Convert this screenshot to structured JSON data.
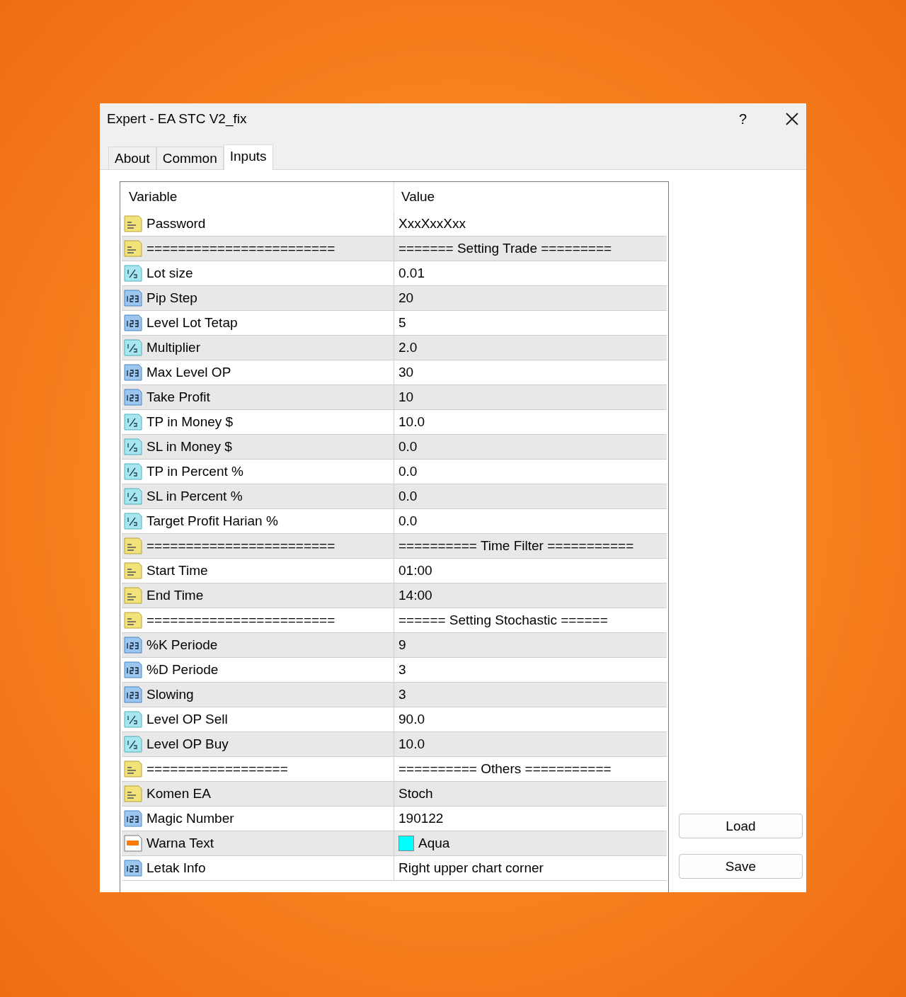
{
  "window": {
    "title": "Expert - EA STC V2_fix",
    "help": "?"
  },
  "tabs": [
    {
      "label": "About",
      "selected": false
    },
    {
      "label": "Common",
      "selected": false
    },
    {
      "label": "Inputs",
      "selected": true
    }
  ],
  "table": {
    "columns": [
      "Variable",
      "Value"
    ],
    "rows": [
      {
        "kind": "string",
        "variable": "Password",
        "value": "XxxXxxXxx"
      },
      {
        "kind": "string",
        "variable": "========================",
        "value": "======= Setting Trade ========="
      },
      {
        "kind": "double",
        "variable": "Lot size",
        "value": "0.01"
      },
      {
        "kind": "int",
        "variable": "Pip Step",
        "value": "20"
      },
      {
        "kind": "int",
        "variable": "Level Lot Tetap",
        "value": "5"
      },
      {
        "kind": "double",
        "variable": "Multiplier",
        "value": "2.0"
      },
      {
        "kind": "int",
        "variable": "Max Level OP",
        "value": "30"
      },
      {
        "kind": "int",
        "variable": "Take Profit",
        "value": "10"
      },
      {
        "kind": "double",
        "variable": "TP in Money $",
        "value": "10.0"
      },
      {
        "kind": "double",
        "variable": "SL in Money $",
        "value": "0.0"
      },
      {
        "kind": "double",
        "variable": "TP in Percent %",
        "value": "0.0"
      },
      {
        "kind": "double",
        "variable": "SL in Percent %",
        "value": "0.0"
      },
      {
        "kind": "double",
        "variable": "Target Profit Harian %",
        "value": "0.0"
      },
      {
        "kind": "string",
        "variable": "========================",
        "value": "========== Time Filter ==========="
      },
      {
        "kind": "string",
        "variable": "Start Time",
        "value": "01:00"
      },
      {
        "kind": "string",
        "variable": "End Time",
        "value": "14:00"
      },
      {
        "kind": "string",
        "variable": "========================",
        "value": "======  Setting Stochastic ======"
      },
      {
        "kind": "int",
        "variable": "%K Periode",
        "value": "9"
      },
      {
        "kind": "int",
        "variable": "%D Periode",
        "value": "3"
      },
      {
        "kind": "int",
        "variable": "Slowing",
        "value": "3"
      },
      {
        "kind": "double",
        "variable": "Level OP Sell",
        "value": "90.0"
      },
      {
        "kind": "double",
        "variable": "Level OP Buy",
        "value": "10.0"
      },
      {
        "kind": "string",
        "variable": "==================",
        "value": "========== Others ==========="
      },
      {
        "kind": "string",
        "variable": "Komen EA",
        "value": "Stoch"
      },
      {
        "kind": "int",
        "variable": "Magic Number",
        "value": "190122"
      },
      {
        "kind": "color",
        "variable": "Warna Text",
        "value": "Aqua",
        "color": "#00ffff"
      },
      {
        "kind": "int",
        "variable": "Letak Info",
        "value": "Right upper chart corner"
      }
    ]
  },
  "buttons": [
    "Load",
    "Save"
  ]
}
